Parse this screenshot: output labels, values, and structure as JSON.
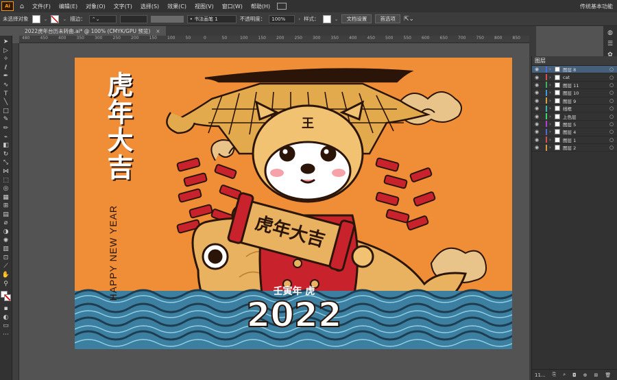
{
  "app": {
    "logo": "Ai",
    "workspace": "传统基本功能"
  },
  "menu": [
    "文件(F)",
    "编辑(E)",
    "对象(O)",
    "文字(T)",
    "选择(S)",
    "效果(C)",
    "视图(V)",
    "窗口(W)",
    "帮助(H)"
  ],
  "control": {
    "no_selection": "未选择对象",
    "stroke_label": "描边：",
    "brush": "• 书法画笔 1",
    "opacity_label": "不透明度：",
    "opacity_value": "100%",
    "style_label": "样式：",
    "doc_setup": "文档设置",
    "preferences": "首选项"
  },
  "document_tab": {
    "title": "2022虎年台历未转曲.ai* @ 100% (CMYK/GPU 预览)",
    "close": "×"
  },
  "ruler": [
    "480",
    "450",
    "400",
    "350",
    "300",
    "250",
    "200",
    "150",
    "100",
    "50",
    "0",
    "50",
    "100",
    "150",
    "200",
    "250",
    "300",
    "350",
    "400",
    "450",
    "500",
    "550",
    "600",
    "650",
    "700",
    "750",
    "800",
    "850"
  ],
  "artwork": {
    "blessing_vertical": "虎年大吉",
    "happy_new_year": "HAPPY NEW YEAR",
    "scroll_text": "虎年大吉",
    "subtitle": "壬寅年 虎",
    "year": "2022",
    "tiger_forehead": "王"
  },
  "layers_panel": {
    "title": "图层",
    "footer_count": "11...",
    "rows": [
      {
        "name": "图层 8",
        "color": "#4f6bd8",
        "selected": true
      },
      {
        "name": "cat",
        "color": "#d84f4f"
      },
      {
        "name": "图层 11",
        "color": "#3fb45a"
      },
      {
        "name": "图层 10",
        "color": "#3f9bd8"
      },
      {
        "name": "图层 9",
        "color": "#d8a23f"
      },
      {
        "name": "线框",
        "color": "#3fb4b4"
      },
      {
        "name": "上色层",
        "color": "#3fd86b"
      },
      {
        "name": "图层 5",
        "color": "#b43fd8"
      },
      {
        "name": "图层 4",
        "color": "#4f6bd8"
      },
      {
        "name": "图层 1",
        "color": "#d84f4f"
      },
      {
        "name": "图层 2",
        "color": "#d89a3f"
      }
    ]
  }
}
